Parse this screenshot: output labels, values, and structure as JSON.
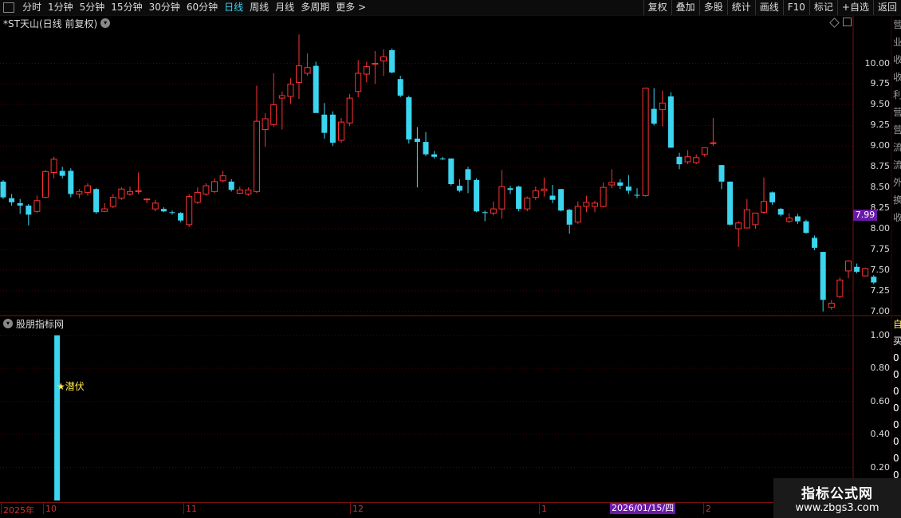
{
  "toolbar": {
    "periods": [
      "分时",
      "1分钟",
      "5分钟",
      "15分钟",
      "30分钟",
      "60分钟",
      "日线",
      "周线",
      "月线",
      "多周期",
      "更多 >"
    ],
    "active_period": "日线",
    "right_buttons": [
      "复权",
      "叠加",
      "多股",
      "统计",
      "画线",
      "F10",
      "标记",
      "+自选",
      "返回"
    ]
  },
  "chart": {
    "title": "*ST天山(日线 前复权)",
    "indicator_title": "股朋指标网",
    "current_price": "7.99",
    "signal_text": "★潜伏",
    "dates": [
      "2025年",
      "10",
      "11",
      "12",
      "1",
      "2"
    ],
    "highlight_date": "2026/01/15/四",
    "colors": {
      "up": "#ff3232",
      "down": "#3bd5ef",
      "grid": "#5a0000"
    }
  },
  "chart_data": [
    {
      "type": "candlestick",
      "title": "*ST天山(日线 前复权)",
      "ylim": [
        6.95,
        10.4
      ],
      "yticks": [
        "10.00",
        "9.75",
        "9.50",
        "9.25",
        "9.00",
        "8.75",
        "8.50",
        "8.25",
        "8.00",
        "7.75",
        "7.50",
        "7.25",
        "7.00"
      ],
      "candles": [
        {
          "o": 8.57,
          "h": 8.59,
          "l": 8.36,
          "c": 8.38
        },
        {
          "o": 8.37,
          "h": 8.42,
          "l": 8.28,
          "c": 8.32
        },
        {
          "o": 8.31,
          "h": 8.36,
          "l": 8.18,
          "c": 8.28
        },
        {
          "o": 8.28,
          "h": 8.3,
          "l": 8.04,
          "c": 8.17
        },
        {
          "o": 8.21,
          "h": 8.4,
          "l": 8.19,
          "c": 8.34
        },
        {
          "o": 8.38,
          "h": 8.71,
          "l": 8.37,
          "c": 8.69
        },
        {
          "o": 8.68,
          "h": 8.87,
          "l": 8.61,
          "c": 8.84
        },
        {
          "o": 8.7,
          "h": 8.75,
          "l": 8.61,
          "c": 8.64
        },
        {
          "o": 8.7,
          "h": 8.73,
          "l": 8.38,
          "c": 8.42
        },
        {
          "o": 8.42,
          "h": 8.48,
          "l": 8.37,
          "c": 8.45
        },
        {
          "o": 8.44,
          "h": 8.55,
          "l": 8.4,
          "c": 8.52
        },
        {
          "o": 8.48,
          "h": 8.49,
          "l": 8.18,
          "c": 8.2
        },
        {
          "o": 8.21,
          "h": 8.31,
          "l": 8.2,
          "c": 8.24
        },
        {
          "o": 8.27,
          "h": 8.42,
          "l": 8.25,
          "c": 8.38
        },
        {
          "o": 8.37,
          "h": 8.5,
          "l": 8.35,
          "c": 8.48
        },
        {
          "o": 8.42,
          "h": 8.51,
          "l": 8.4,
          "c": 8.45
        },
        {
          "o": 8.45,
          "h": 8.68,
          "l": 8.42,
          "c": 8.46
        },
        {
          "o": 8.36,
          "h": 8.37,
          "l": 8.31,
          "c": 8.36
        },
        {
          "o": 8.24,
          "h": 8.35,
          "l": 8.21,
          "c": 8.31
        },
        {
          "o": 8.24,
          "h": 8.26,
          "l": 8.2,
          "c": 8.21
        },
        {
          "o": 8.2,
          "h": 8.22,
          "l": 8.17,
          "c": 8.19
        },
        {
          "o": 8.19,
          "h": 8.2,
          "l": 8.08,
          "c": 8.1
        },
        {
          "o": 8.05,
          "h": 8.42,
          "l": 8.02,
          "c": 8.39
        },
        {
          "o": 8.32,
          "h": 8.5,
          "l": 8.3,
          "c": 8.44
        },
        {
          "o": 8.42,
          "h": 8.55,
          "l": 8.4,
          "c": 8.52
        },
        {
          "o": 8.45,
          "h": 8.61,
          "l": 8.43,
          "c": 8.57
        },
        {
          "o": 8.58,
          "h": 8.7,
          "l": 8.56,
          "c": 8.64
        },
        {
          "o": 8.57,
          "h": 8.6,
          "l": 8.45,
          "c": 8.47
        },
        {
          "o": 8.43,
          "h": 8.51,
          "l": 8.42,
          "c": 8.47
        },
        {
          "o": 8.42,
          "h": 8.5,
          "l": 8.4,
          "c": 8.47
        },
        {
          "o": 8.45,
          "h": 9.73,
          "l": 8.43,
          "c": 9.3
        },
        {
          "o": 9.2,
          "h": 9.4,
          "l": 8.99,
          "c": 9.33
        },
        {
          "o": 9.26,
          "h": 9.88,
          "l": 9.23,
          "c": 9.5
        },
        {
          "o": 9.58,
          "h": 9.66,
          "l": 9.2,
          "c": 9.61
        },
        {
          "o": 9.6,
          "h": 9.82,
          "l": 9.51,
          "c": 9.75
        },
        {
          "o": 9.77,
          "h": 10.35,
          "l": 9.57,
          "c": 9.97
        },
        {
          "o": 9.88,
          "h": 10.12,
          "l": 9.85,
          "c": 9.95
        },
        {
          "o": 9.97,
          "h": 10.02,
          "l": 9.42,
          "c": 9.4
        },
        {
          "o": 9.38,
          "h": 9.52,
          "l": 9.09,
          "c": 9.16
        },
        {
          "o": 9.38,
          "h": 9.42,
          "l": 9.0,
          "c": 9.04
        },
        {
          "o": 9.07,
          "h": 9.34,
          "l": 9.04,
          "c": 9.29
        },
        {
          "o": 9.28,
          "h": 9.63,
          "l": 9.24,
          "c": 9.58
        },
        {
          "o": 9.66,
          "h": 10.04,
          "l": 9.59,
          "c": 9.88
        },
        {
          "o": 9.87,
          "h": 10.02,
          "l": 9.77,
          "c": 9.96
        },
        {
          "o": 9.99,
          "h": 10.15,
          "l": 9.75,
          "c": 10.0
        },
        {
          "o": 10.03,
          "h": 10.17,
          "l": 9.85,
          "c": 10.08
        },
        {
          "o": 10.16,
          "h": 10.18,
          "l": 9.88,
          "c": 9.89
        },
        {
          "o": 9.81,
          "h": 9.85,
          "l": 9.59,
          "c": 9.61
        },
        {
          "o": 9.59,
          "h": 9.61,
          "l": 9.03,
          "c": 9.08
        },
        {
          "o": 9.09,
          "h": 9.23,
          "l": 8.5,
          "c": 9.05
        },
        {
          "o": 9.05,
          "h": 9.17,
          "l": 8.88,
          "c": 8.9
        },
        {
          "o": 8.9,
          "h": 8.94,
          "l": 8.85,
          "c": 8.87
        },
        {
          "o": 8.85,
          "h": 8.87,
          "l": 8.83,
          "c": 8.84
        },
        {
          "o": 8.85,
          "h": 8.85,
          "l": 8.52,
          "c": 8.54
        },
        {
          "o": 8.52,
          "h": 8.6,
          "l": 8.44,
          "c": 8.46
        },
        {
          "o": 8.72,
          "h": 8.75,
          "l": 8.43,
          "c": 8.59
        },
        {
          "o": 8.59,
          "h": 8.61,
          "l": 8.2,
          "c": 8.21
        },
        {
          "o": 8.2,
          "h": 8.22,
          "l": 8.09,
          "c": 8.19
        },
        {
          "o": 8.19,
          "h": 8.33,
          "l": 8.16,
          "c": 8.24
        },
        {
          "o": 8.24,
          "h": 8.71,
          "l": 8.12,
          "c": 8.51
        },
        {
          "o": 8.49,
          "h": 8.52,
          "l": 8.42,
          "c": 8.47
        },
        {
          "o": 8.51,
          "h": 8.52,
          "l": 8.21,
          "c": 8.24
        },
        {
          "o": 8.24,
          "h": 8.39,
          "l": 8.21,
          "c": 8.37
        },
        {
          "o": 8.38,
          "h": 8.51,
          "l": 8.35,
          "c": 8.46
        },
        {
          "o": 8.46,
          "h": 8.62,
          "l": 8.39,
          "c": 8.48
        },
        {
          "o": 8.4,
          "h": 8.53,
          "l": 8.31,
          "c": 8.35
        },
        {
          "o": 8.48,
          "h": 8.48,
          "l": 8.21,
          "c": 8.22
        },
        {
          "o": 8.23,
          "h": 8.24,
          "l": 7.94,
          "c": 8.05
        },
        {
          "o": 8.08,
          "h": 8.33,
          "l": 8.06,
          "c": 8.27
        },
        {
          "o": 8.27,
          "h": 8.4,
          "l": 8.2,
          "c": 8.32
        },
        {
          "o": 8.27,
          "h": 8.34,
          "l": 8.2,
          "c": 8.31
        },
        {
          "o": 8.27,
          "h": 8.56,
          "l": 8.26,
          "c": 8.5
        },
        {
          "o": 8.53,
          "h": 8.72,
          "l": 8.49,
          "c": 8.56
        },
        {
          "o": 8.56,
          "h": 8.6,
          "l": 8.48,
          "c": 8.52
        },
        {
          "o": 8.51,
          "h": 8.65,
          "l": 8.42,
          "c": 8.46
        },
        {
          "o": 8.41,
          "h": 8.49,
          "l": 8.37,
          "c": 8.4
        },
        {
          "o": 8.4,
          "h": 9.7,
          "l": 8.39,
          "c": 9.7
        },
        {
          "o": 9.45,
          "h": 9.7,
          "l": 9.25,
          "c": 9.27
        },
        {
          "o": 9.44,
          "h": 9.67,
          "l": 9.24,
          "c": 9.52
        },
        {
          "o": 9.6,
          "h": 9.65,
          "l": 8.98,
          "c": 8.98
        },
        {
          "o": 8.87,
          "h": 8.92,
          "l": 8.72,
          "c": 8.78
        },
        {
          "o": 8.81,
          "h": 8.95,
          "l": 8.78,
          "c": 8.87
        },
        {
          "o": 8.8,
          "h": 8.9,
          "l": 8.78,
          "c": 8.86
        },
        {
          "o": 8.9,
          "h": 8.98,
          "l": 8.87,
          "c": 8.98
        },
        {
          "o": 9.04,
          "h": 9.34,
          "l": 9.0,
          "c": 9.04
        },
        {
          "o": 8.77,
          "h": 8.77,
          "l": 8.48,
          "c": 8.57
        },
        {
          "o": 8.57,
          "h": 8.57,
          "l": 8.04,
          "c": 8.05
        },
        {
          "o": 8.0,
          "h": 8.09,
          "l": 7.78,
          "c": 8.07
        },
        {
          "o": 8.01,
          "h": 8.36,
          "l": 8.01,
          "c": 8.23
        },
        {
          "o": 8.05,
          "h": 8.18,
          "l": 8.0,
          "c": 8.19
        },
        {
          "o": 8.2,
          "h": 8.62,
          "l": 8.18,
          "c": 8.33
        },
        {
          "o": 8.44,
          "h": 8.45,
          "l": 8.29,
          "c": 8.32
        },
        {
          "o": 8.24,
          "h": 8.25,
          "l": 8.15,
          "c": 8.17
        },
        {
          "o": 8.09,
          "h": 8.19,
          "l": 8.07,
          "c": 8.13
        },
        {
          "o": 8.15,
          "h": 8.18,
          "l": 8.06,
          "c": 8.09
        },
        {
          "o": 8.09,
          "h": 8.11,
          "l": 7.94,
          "c": 7.95
        },
        {
          "o": 7.89,
          "h": 7.92,
          "l": 7.74,
          "c": 7.77
        },
        {
          "o": 7.72,
          "h": 7.72,
          "l": 7.0,
          "c": 7.14
        },
        {
          "o": 7.05,
          "h": 7.14,
          "l": 7.02,
          "c": 7.1
        },
        {
          "o": 7.18,
          "h": 7.41,
          "l": 7.16,
          "c": 7.38
        },
        {
          "o": 7.49,
          "h": 7.62,
          "l": 7.4,
          "c": 7.61
        },
        {
          "o": 7.54,
          "h": 7.58,
          "l": 7.46,
          "c": 7.48
        },
        {
          "o": 7.43,
          "h": 7.53,
          "l": 7.42,
          "c": 7.52
        },
        {
          "o": 7.42,
          "h": 7.44,
          "l": 7.33,
          "c": 7.35
        }
      ]
    },
    {
      "type": "bar",
      "title": "股朋指标网",
      "ylim": [
        0,
        1.1
      ],
      "yticks": [
        "1.00",
        "0.80",
        "0.60",
        "0.40",
        "0.20"
      ],
      "bars": [
        {
          "index": 6,
          "value": 1.0
        }
      ]
    }
  ]
}
